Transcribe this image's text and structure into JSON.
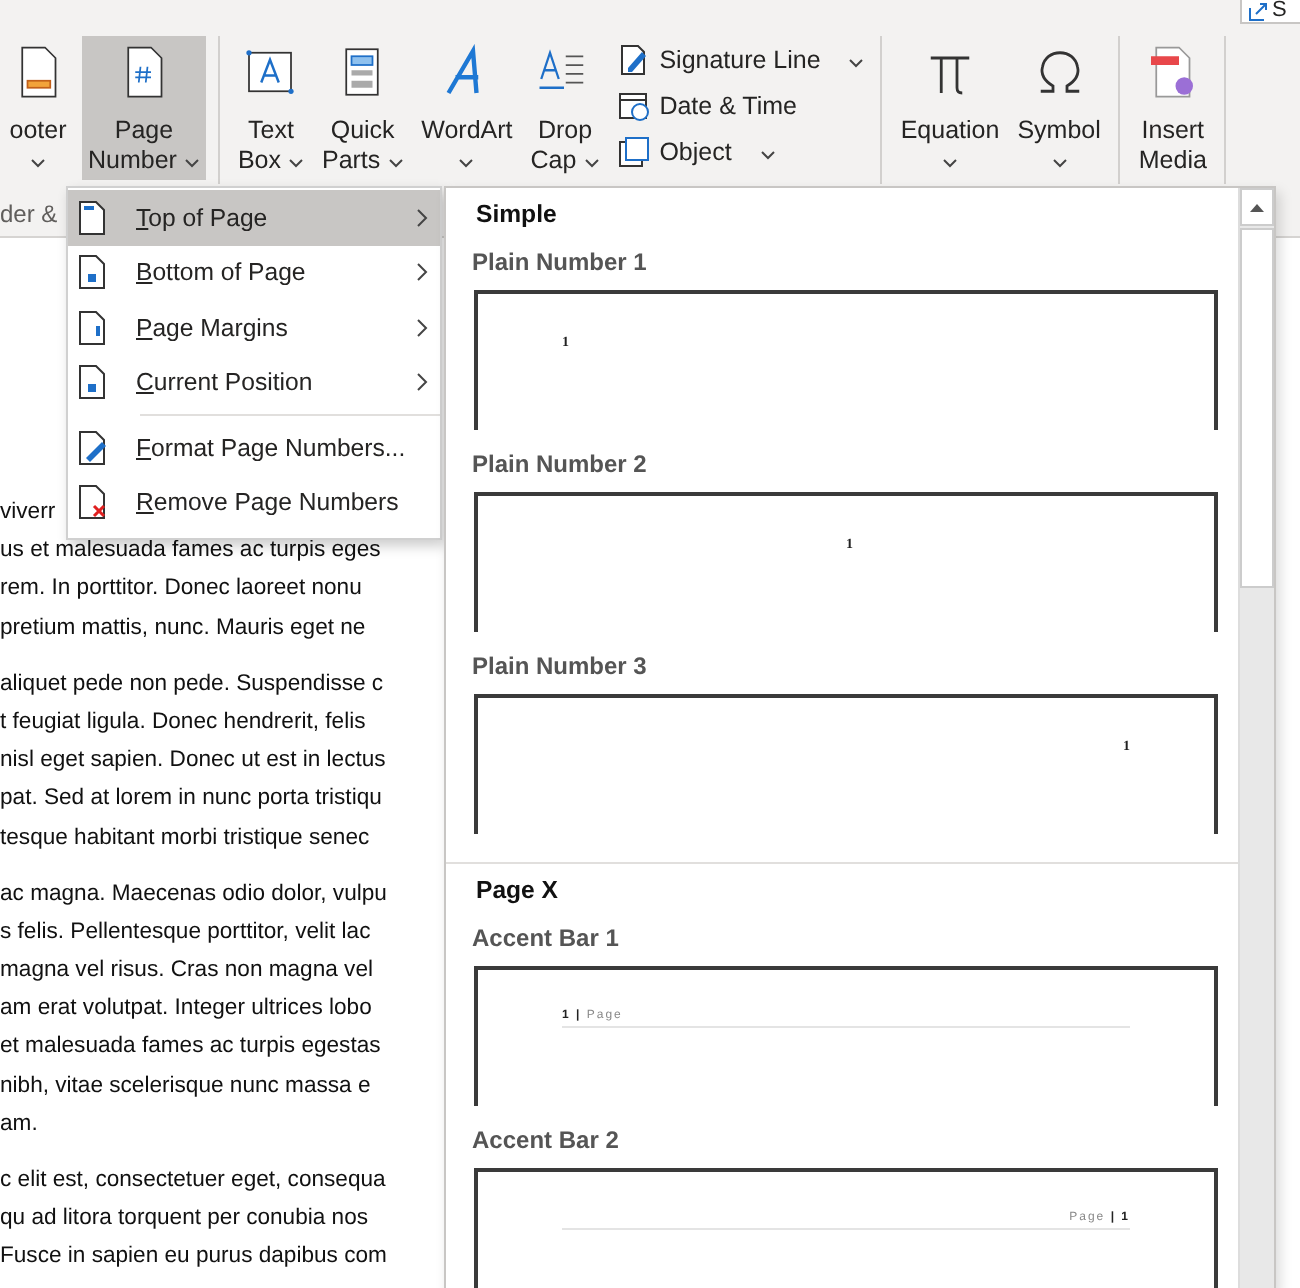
{
  "ribbon": {
    "corner_button": "S",
    "group_label": "der &",
    "groups": [
      {
        "buttons": [
          {
            "kind": "large",
            "lines": [
              "ooter"
            ],
            "caret": true,
            "selected": false
          },
          {
            "kind": "large",
            "lines": [
              "Page",
              "Number"
            ],
            "caret": true,
            "selected": true
          }
        ]
      },
      {
        "buttons": [
          {
            "kind": "large",
            "lines": [
              "Text",
              "Box"
            ],
            "caret": true,
            "selected": false
          },
          {
            "kind": "large",
            "lines": [
              "Quick",
              "Parts"
            ],
            "caret": true,
            "selected": false
          },
          {
            "kind": "large",
            "lines": [
              "WordArt"
            ],
            "caret": true,
            "selected": false
          },
          {
            "kind": "large",
            "lines": [
              "Drop",
              "Cap"
            ],
            "caret": true,
            "selected": false
          },
          {
            "kind": "stack",
            "items": [
              {
                "label": "Signature Line",
                "caret": true
              },
              {
                "label": "Date & Time",
                "caret": false
              },
              {
                "label": "Object",
                "caret": true
              }
            ]
          }
        ]
      },
      {
        "buttons": [
          {
            "kind": "large",
            "lines": [
              "Equation"
            ],
            "caret": true,
            "selected": false
          },
          {
            "kind": "large",
            "lines": [
              "Symbol"
            ],
            "caret": true,
            "selected": false
          }
        ]
      },
      {
        "buttons": [
          {
            "kind": "large",
            "lines": [
              "Insert",
              "Media"
            ],
            "caret": false,
            "selected": false
          }
        ]
      }
    ]
  },
  "document": {
    "paragraphs": [
      [
        "viverr",
        "us et malesuada fames ac turpis eges",
        "rem. In porttitor. Donec laoreet nonu",
        "pretium mattis, nunc. Mauris eget ne"
      ],
      [
        "aliquet pede non pede. Suspendisse c",
        "t feugiat ligula. Donec hendrerit, felis",
        "nisl eget sapien. Donec ut est in lectus",
        "pat. Sed at lorem in nunc porta tristiqu",
        "tesque habitant morbi tristique senec"
      ],
      [
        "ac magna. Maecenas odio dolor, vulpu",
        "s felis. Pellentesque porttitor, velit lac",
        "magna vel risus. Cras non magna vel",
        "am erat volutpat. Integer ultrices lobo",
        "et malesuada fames ac turpis egestas",
        "nibh, vitae scelerisque nunc massa e",
        "am."
      ],
      [
        "c elit est, consectetuer eget, consequa",
        "qu ad litora torquent per conubia nos",
        "Fusce in sapien eu purus dapibus com"
      ]
    ]
  },
  "menu": {
    "items": [
      {
        "kind": "submenu",
        "label": "Top of Page",
        "selected": true
      },
      {
        "kind": "submenu",
        "label": "Bottom of Page",
        "selected": false
      },
      {
        "kind": "submenu",
        "label": "Page Margins",
        "selected": false
      },
      {
        "kind": "submenu",
        "label": "Current Position",
        "selected": false
      },
      {
        "kind": "separator"
      },
      {
        "kind": "command",
        "label": "Format Page Numbers...",
        "selected": false
      },
      {
        "kind": "command",
        "label": "Remove Page Numbers",
        "selected": false
      }
    ]
  },
  "gallery": {
    "sections": [
      {
        "heading": "Simple",
        "items": [
          {
            "name": "Plain Number 1",
            "kind": "plain",
            "preview": {
              "kind": "left",
              "text": "1"
            }
          },
          {
            "name": "Plain Number 2",
            "kind": "plain",
            "preview": {
              "kind": "center",
              "text": "1"
            }
          },
          {
            "name": "Plain Number 3",
            "kind": "plain",
            "preview": {
              "kind": "right",
              "text": "1"
            }
          }
        ]
      },
      {
        "heading": "Page X",
        "items": [
          {
            "name": "Accent Bar 1",
            "kind": "accent",
            "preview": {
              "kind": "left",
              "text": "**1 |** Page"
            }
          },
          {
            "name": "Accent Bar 2",
            "kind": "accent",
            "preview": {
              "kind": "right",
              "text": "Page **| 1**"
            }
          }
        ]
      }
    ]
  }
}
